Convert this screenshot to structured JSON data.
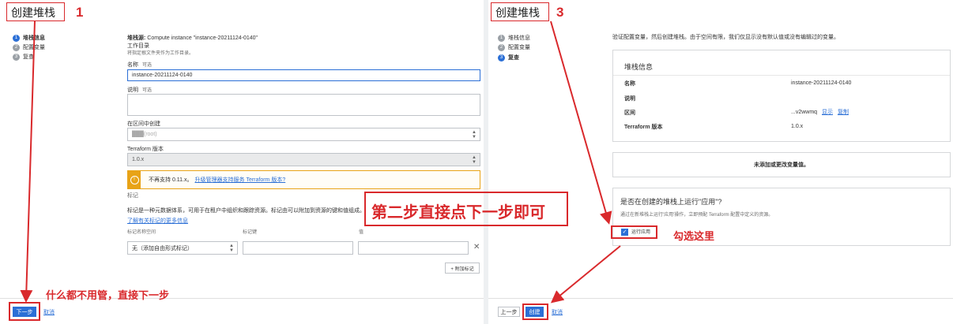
{
  "left_panel": {
    "header": "创建堆栈",
    "badge": "1",
    "steps": [
      {
        "num": "1",
        "label": "堆栈信息"
      },
      {
        "num": "2",
        "label": "配置变量"
      },
      {
        "num": "3",
        "label": "复查"
      }
    ],
    "stack_source_label": "堆栈源:",
    "stack_source_value": "Compute instance \"instance-20211124-0140\"",
    "workdir_label": "工作目录",
    "workdir_hint": "将指定根文件夹作为工作目录。",
    "name_label": "名称",
    "name_optional": "可选",
    "name_value": "instance-20211124-0140",
    "desc_label": "说明",
    "desc_optional": "可选",
    "compartment_label": "在区间中创建",
    "compartment_value": "███(root)",
    "terraform_label": "Terraform 版本",
    "terraform_value": "1.0.x",
    "warning_text": "不再支持 0.11.x。",
    "warning_link": "升级管理器支持服务 Terraform 版本?",
    "tags_label": "标记",
    "tags_desc": "标记是一种元数据体系，可用于在租户中组织和跟踪资源。标记由可以附加到资源的键和值组成。",
    "tags_link": "了解有关标记的更多信息",
    "col_namespace": "标记名称空间",
    "col_key": "标记键",
    "col_value": "值",
    "namespace_select": "无（添加自由形式标记）",
    "add_tag": "+ 附加标记",
    "next_button": "下一步",
    "cancel_link": "取消"
  },
  "right_panel": {
    "header": "创建堆栈",
    "badge": "3",
    "steps": [
      {
        "num": "1",
        "label": "堆栈信息"
      },
      {
        "num": "2",
        "label": "配置变量"
      },
      {
        "num": "3",
        "label": "复查"
      }
    ],
    "intro": "验证配置变量，然后创建堆栈。由于空间有限，我们仅显示没有默认值或没有编辑过的变量。",
    "stack_info_title": "堆栈信息",
    "rows": [
      {
        "key": "名称",
        "value": "instance-20211124-0140"
      },
      {
        "key": "说明",
        "value": ""
      },
      {
        "key": "区间",
        "value": "...v2wwmq"
      },
      {
        "key": "Terraform 版本",
        "value": "1.0.x"
      }
    ],
    "show_link": "显示",
    "copy_link": "复制",
    "no_vars": "未添加或更改变量值。",
    "apply_question": "是否在创建的堆栈上运行\"应用\"?",
    "apply_desc": "通过在新堆栈上运行'应用'操作，立即预配 Terraform 配置中定义的资源。",
    "apply_checkbox": "运行应用",
    "back_button": "上一步",
    "create_button": "创建",
    "cancel_link": "取消"
  },
  "annotations": {
    "middle": "第二步直接点下一步即可",
    "bottom_left": "什么都不用管，直接下一步",
    "check_here": "勾选这里"
  },
  "colors": {
    "accent": "#2b6fd6",
    "annotation": "#d9292c",
    "warning": "#e8a317"
  }
}
